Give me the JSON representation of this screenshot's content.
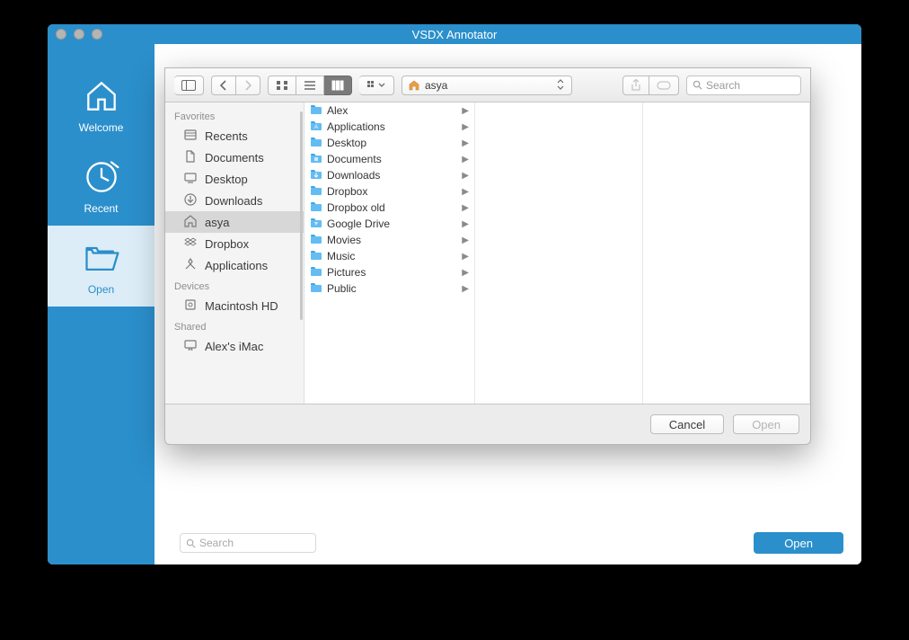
{
  "title": "VSDX Annotator",
  "sidebar": {
    "items": [
      {
        "label": "Welcome"
      },
      {
        "label": "Recent"
      },
      {
        "label": "Open"
      }
    ]
  },
  "bottombar": {
    "search_placeholder": "Search",
    "open_label": "Open"
  },
  "dialog": {
    "path_label": "asya",
    "search_placeholder": "Search",
    "sidebar": {
      "groups": [
        {
          "title": "Favorites",
          "items": [
            {
              "label": "Recents",
              "icon": "recents"
            },
            {
              "label": "Documents",
              "icon": "documents"
            },
            {
              "label": "Desktop",
              "icon": "desktop"
            },
            {
              "label": "Downloads",
              "icon": "downloads"
            },
            {
              "label": "asya",
              "icon": "home",
              "selected": true
            },
            {
              "label": "Dropbox",
              "icon": "dropbox"
            },
            {
              "label": "Applications",
              "icon": "applications"
            }
          ]
        },
        {
          "title": "Devices",
          "items": [
            {
              "label": "Macintosh HD",
              "icon": "disk"
            }
          ]
        },
        {
          "title": "Shared",
          "items": [
            {
              "label": "Alex's iMac",
              "icon": "imac"
            }
          ]
        }
      ]
    },
    "column": [
      {
        "label": "Alex",
        "icon": "folder"
      },
      {
        "label": "Applications",
        "icon": "app-folder"
      },
      {
        "label": "Desktop",
        "icon": "folder"
      },
      {
        "label": "Documents",
        "icon": "doc-folder"
      },
      {
        "label": "Downloads",
        "icon": "dl-folder"
      },
      {
        "label": "Dropbox",
        "icon": "folder"
      },
      {
        "label": "Dropbox old",
        "icon": "folder"
      },
      {
        "label": "Google Drive",
        "icon": "gd-folder"
      },
      {
        "label": "Movies",
        "icon": "folder"
      },
      {
        "label": "Music",
        "icon": "folder"
      },
      {
        "label": "Pictures",
        "icon": "folder"
      },
      {
        "label": "Public",
        "icon": "folder"
      }
    ],
    "footer": {
      "cancel_label": "Cancel",
      "open_label": "Open"
    }
  }
}
